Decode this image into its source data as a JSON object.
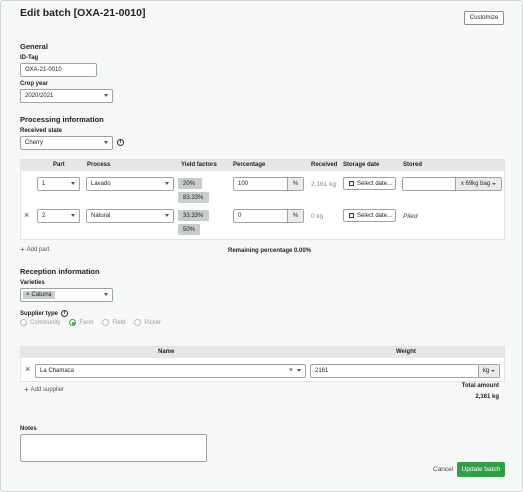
{
  "header": {
    "title": "Edit batch [OXA-21-0010]",
    "customize_label": "Customize"
  },
  "general": {
    "title": "General",
    "id_tag_label": "ID-Tag",
    "id_tag_value": "OXA-21-0010",
    "crop_year_label": "Crop year",
    "crop_year_value": "2020/2021"
  },
  "processing": {
    "title": "Processing information",
    "received_state_label": "Received state",
    "received_state_value": "Cherry",
    "info_icon": "info-icon",
    "columns": [
      "Part",
      "Process",
      "Yield factors",
      "Percentage",
      "Received",
      "Storage date",
      "Stored"
    ],
    "rows": [
      {
        "part": "1",
        "process": "Lavado",
        "yields": [
          "20%",
          "83.33%"
        ],
        "percentage": "100",
        "unit": "%",
        "received": "2,161 kg",
        "storage_date": "Select date...",
        "stored_value": "",
        "stored_unit": "x 69kg bag"
      },
      {
        "part": "2",
        "process": "Natural",
        "yields": [
          "33.33%",
          "50%"
        ],
        "percentage": "0",
        "unit": "%",
        "received": "0 kg",
        "storage_date": "Select date...",
        "stored_value": "Piled",
        "remove": "×"
      }
    ],
    "add_part_label": "Add part",
    "remaining_label": "Remaining percentage 0.00%"
  },
  "reception": {
    "title": "Reception information",
    "varieties_label": "Varieties",
    "varieties": [
      "Caturra"
    ],
    "supplier_type_label": "Supplier type",
    "supplier_types": [
      "Community",
      "Farm",
      "Field",
      "Picker"
    ],
    "selected_supplier_type": "Farm",
    "suppliers_table": {
      "col_name": "Name",
      "col_weight": "Weight",
      "rows": [
        {
          "name": "La Chamaca",
          "weight": "2161",
          "unit": "kg"
        }
      ]
    },
    "add_supplier_label": "Add supplier",
    "total_label": "Total amount",
    "total_value": "2,161 kg"
  },
  "notes": {
    "label": "Notes",
    "value": ""
  },
  "footer": {
    "cancel_label": "Cancel",
    "update_label": "Update batch"
  },
  "colors": {
    "accent": "#2f9e44",
    "table_header": "#e5e7e7",
    "chip": "#c8cccc"
  }
}
